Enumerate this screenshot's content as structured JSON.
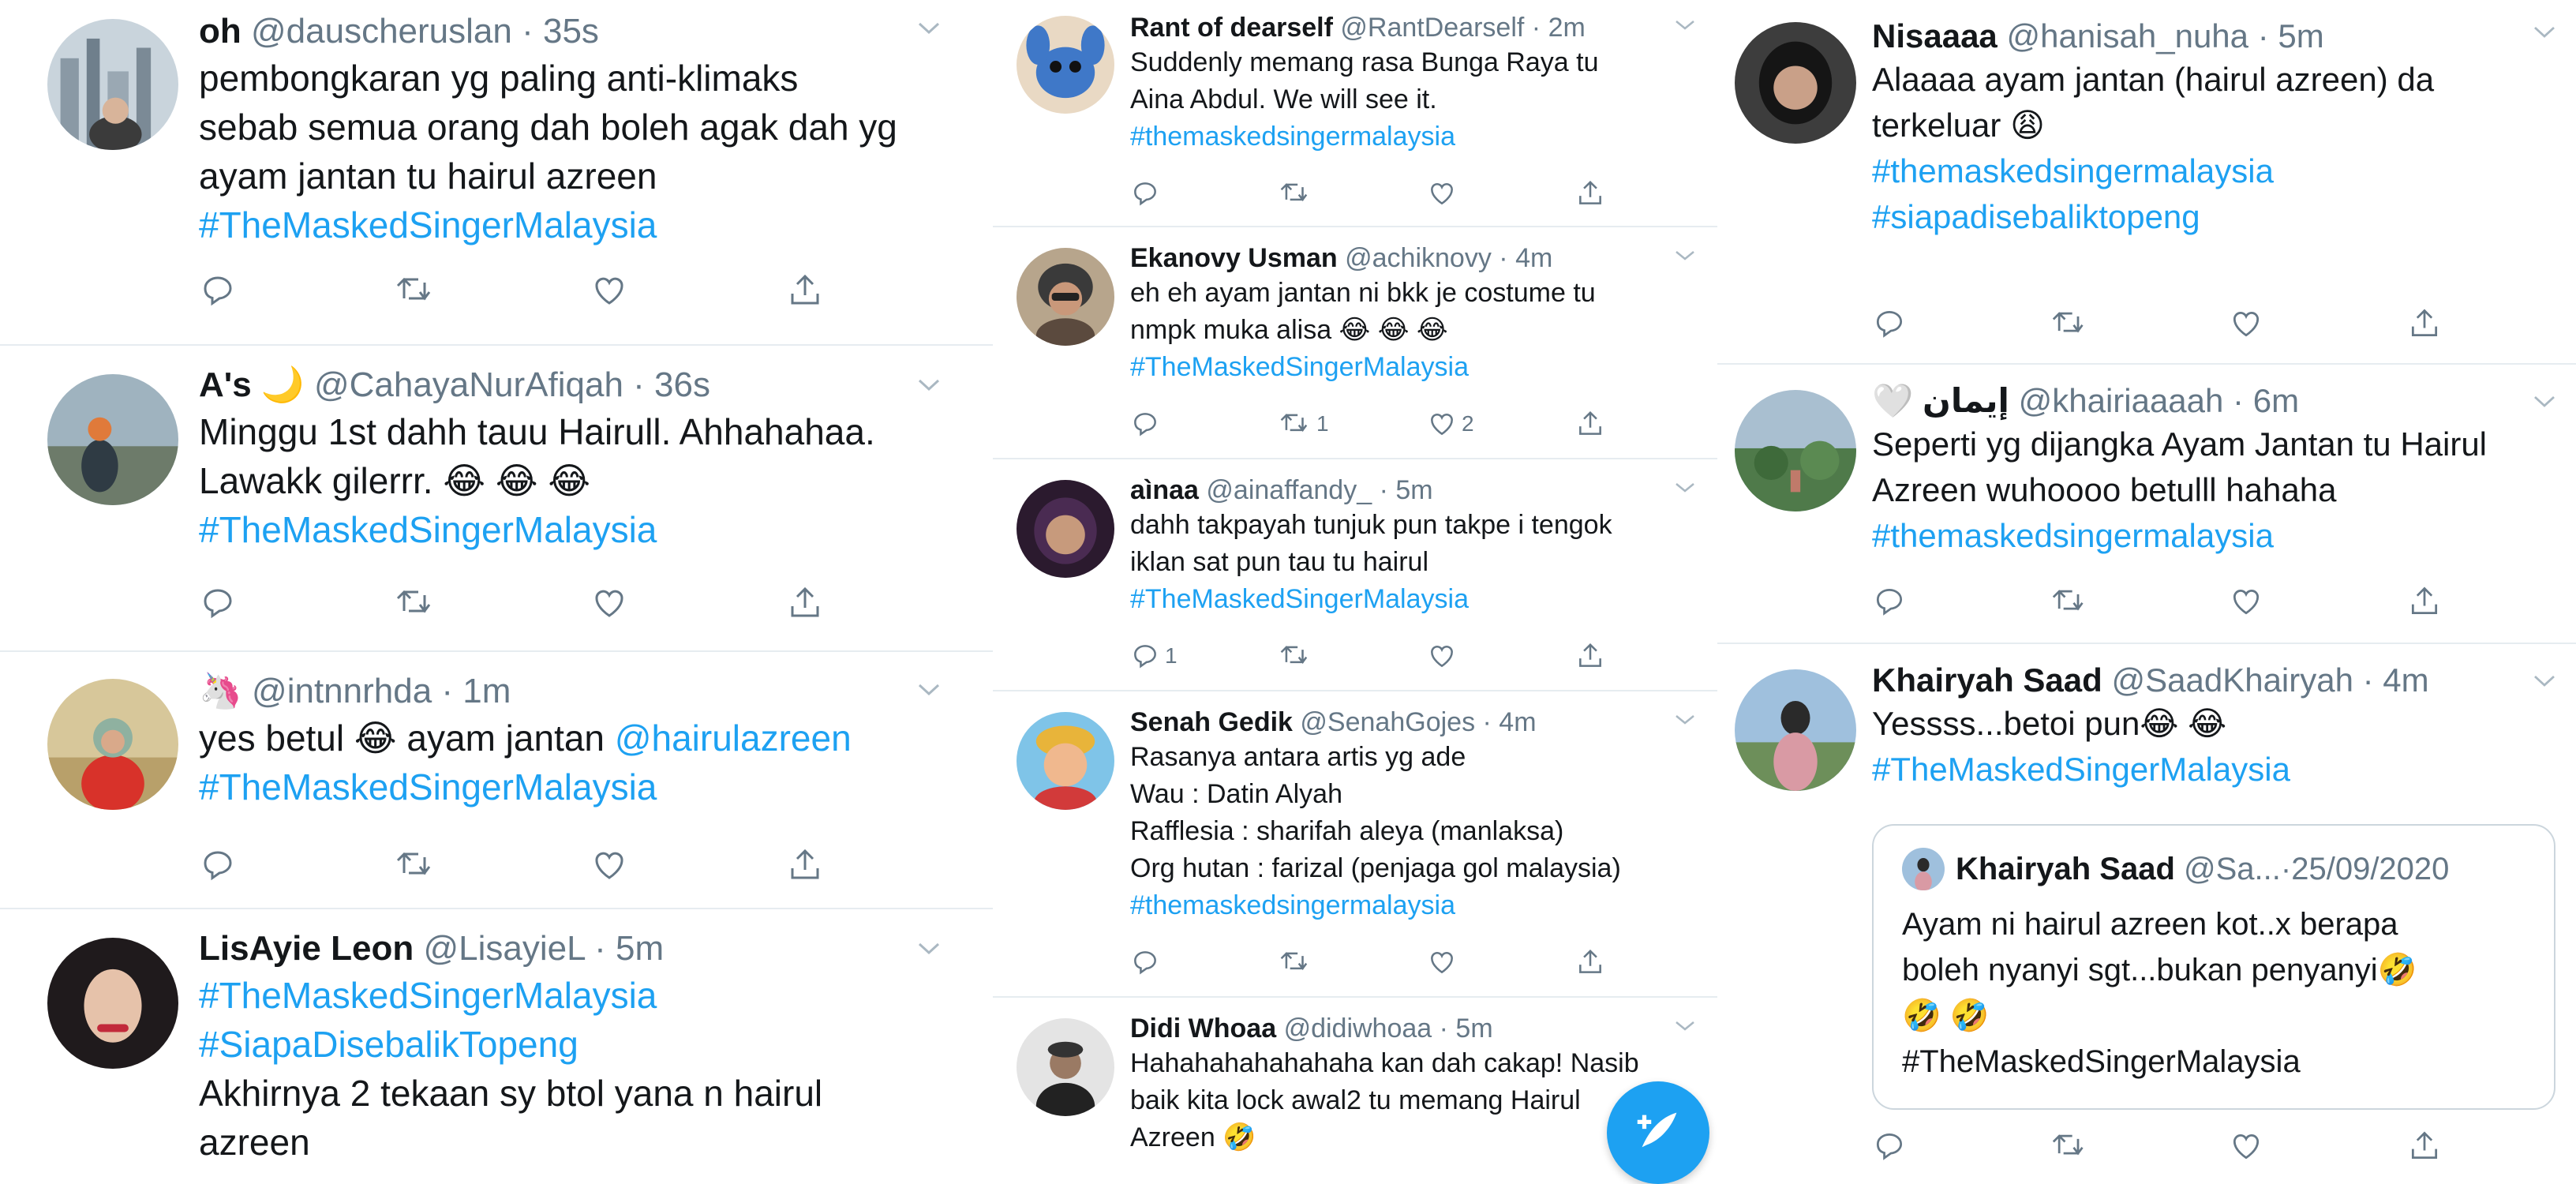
{
  "colors": {
    "accent": "#1da1f2",
    "secondary": "#657786",
    "text": "#14171a",
    "divider": "#e6ecf0"
  },
  "icons": {
    "reply": "reply-icon",
    "retweet": "retweet-icon",
    "like": "like-icon",
    "share": "share-icon",
    "more": "chevron-down-icon",
    "compose": "compose-tweet-icon"
  },
  "columns": [
    {
      "tweets": [
        {
          "name": "oh",
          "handle": "@dauscheruslan",
          "time": "35s",
          "text": "pembongkaran yg paling anti-klimaks\nsebab semua orang dah boleh agak dah yg\nayam jantan tu hairul azreen",
          "tags": [
            "#TheMaskedSingerMalaysia"
          ]
        },
        {
          "name": "A's 🌙",
          "handle": "@CahayaNurAfiqah",
          "time": "36s",
          "text": "Minggu 1st dahh tauu Hairull. Ahhahahaa.\nLawakk gilerrr. 😂 😂 😂",
          "tags": [
            "#TheMaskedSingerMalaysia"
          ]
        },
        {
          "name": "🦄",
          "handle": "@intnnrhda",
          "time": "1m",
          "text": "yes betul 😂 ayam jantan ",
          "mention": "@hairulazreen",
          "tags": [
            "#TheMaskedSingerMalaysia"
          ]
        },
        {
          "name": "LisAyie Leon",
          "handle": "@LisayieL",
          "time": "5m",
          "tags": [
            "#TheMaskedSingerMalaysia",
            "#SiapaDisebalikTopeng"
          ],
          "text": "Akhirnya 2 tekaan sy btol yana n hairul\nazreen"
        }
      ]
    },
    {
      "tweets": [
        {
          "name": "Rant of dearself",
          "handle": "@RantDearself",
          "time": "2m",
          "text": "Suddenly memang rasa Bunga Raya tu\nAina Abdul. We will see it.",
          "tags": [
            "#themaskedsingermalaysia"
          ]
        },
        {
          "name": "Ekanovy Usman",
          "handle": "@achiknovy",
          "time": "4m",
          "text": "eh eh ayam jantan ni bkk je costume tu\nnmpk muka alisa 😂 😂 😂",
          "tags": [
            "#TheMaskedSingerMalaysia"
          ],
          "retweets": "1",
          "likes": "2"
        },
        {
          "name": "aìnaa",
          "handle": "@ainaffandy_",
          "time": "5m",
          "text": "dahh takpayah tunjuk pun takpe i tengok\niklan sat pun tau tu hairul",
          "tags": [
            "#TheMaskedSingerMalaysia"
          ],
          "replies": "1"
        },
        {
          "name": "Senah Gedik",
          "handle": "@SenahGojes",
          "time": "4m",
          "text": "Rasanya antara artis yg ade\nWau : Datin Alyah\nRafflesia : sharifah aleya (manlaksa)\nOrg hutan : farizal (penjaga gol malaysia)",
          "tags": [
            "#themaskedsingermalaysia"
          ]
        },
        {
          "name": "Didi Whoaa",
          "handle": "@didiwhoaa",
          "time": "5m",
          "text": "Hahahahahahahaha kan dah cakap! Nasib\nbaik kita lock awal2 tu memang Hairul\nAzreen 🤣"
        }
      ]
    },
    {
      "tweets": [
        {
          "name": "Nisaaaa",
          "handle": "@hanisah_nuha",
          "time": "5m",
          "text": "Alaaaa ayam jantan (hairul azreen) da\nterkeluar 😩\n",
          "tags": [
            "#themaskedsingermalaysia",
            "#siapadisebaliktopeng"
          ]
        },
        {
          "name": "🤍 إيمان",
          "handle": "@khairiaaaah",
          "time": "6m",
          "text": "Seperti yg dijangka Ayam Jantan tu Hairul\nAzreen wuhoooo betulll hahaha",
          "tags": [
            "#themaskedsingermalaysia"
          ]
        },
        {
          "name": "Khairyah Saad",
          "handle": "@SaadKhairyah",
          "time": "4m",
          "text": "Yessss...betoi pun😂 😂",
          "tags": [
            "#TheMaskedSingerMalaysia"
          ],
          "quote": {
            "name": "Khairyah Saad",
            "handle": "@Sa...",
            "date": "25/09/2020",
            "text": "Ayam ni hairul azreen kot..x berapa\nboleh nyanyi sgt...bukan penyanyi🤣\n🤣 🤣\n#TheMaskedSingerMalaysia"
          }
        }
      ]
    }
  ]
}
